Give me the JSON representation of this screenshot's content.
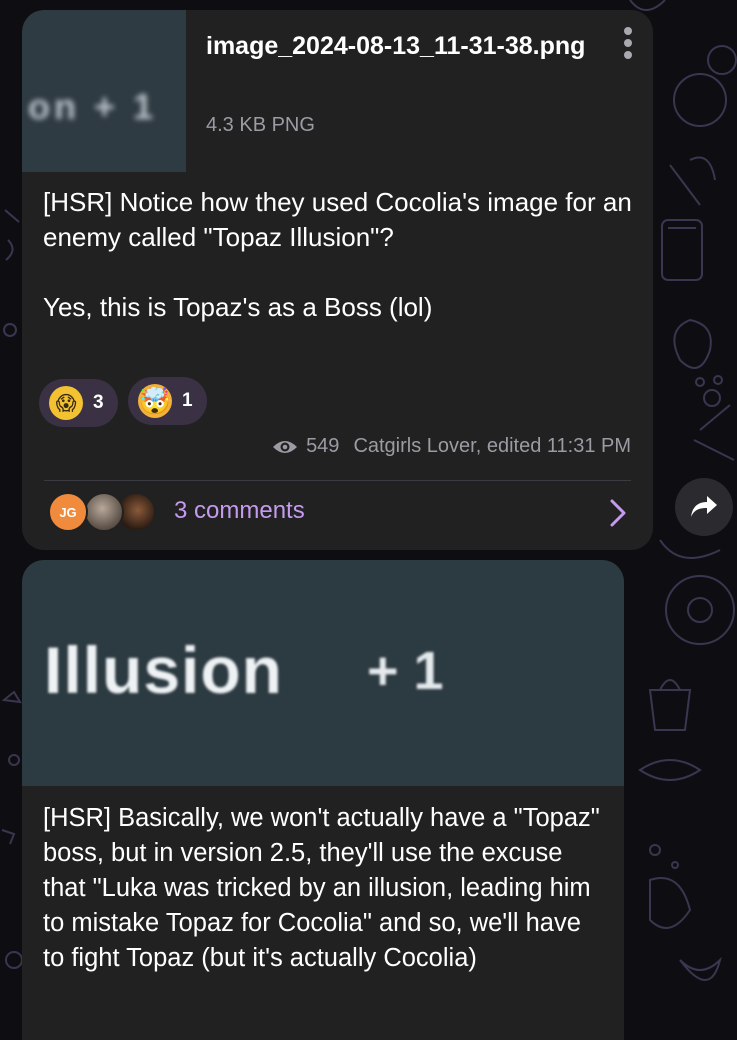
{
  "message1": {
    "file": {
      "thumbnail_text": "on   + 1",
      "name": "image_2024-08-13_11-31-38.png",
      "meta": "4.3 KB PNG"
    },
    "text": "[HSR] Notice how they used Cocolia's image for an enemy called \"Topaz Illusion\"?\n\nYes, this is Topaz's as a Boss (lol)",
    "reactions": [
      {
        "emoji": "😱",
        "icon": "screaming-face-icon",
        "count": "3"
      },
      {
        "emoji": "🤯",
        "icon": "exploding-head-icon",
        "count": "1"
      }
    ],
    "views": "549",
    "author_edited_time": "Catgirls Lover, edited 11:31 PM",
    "comments": {
      "avatar_initials": "JG",
      "label": "3 comments"
    }
  },
  "message2": {
    "preview": {
      "word": "Illusion",
      "suffix": "+ 1"
    },
    "text": "[HSR] Basically, we won't actually have a \"Topaz\" boss, but in version 2.5, they'll use the excuse that \"Luka was tricked by an illusion, leading him to mistake Topaz for Cocolia\" and so, we'll have to fight Topaz (but it's actually Cocolia)"
  },
  "colors": {
    "bubble": "#212121",
    "accent": "#c59bf0",
    "muted": "#9b9ba3"
  }
}
